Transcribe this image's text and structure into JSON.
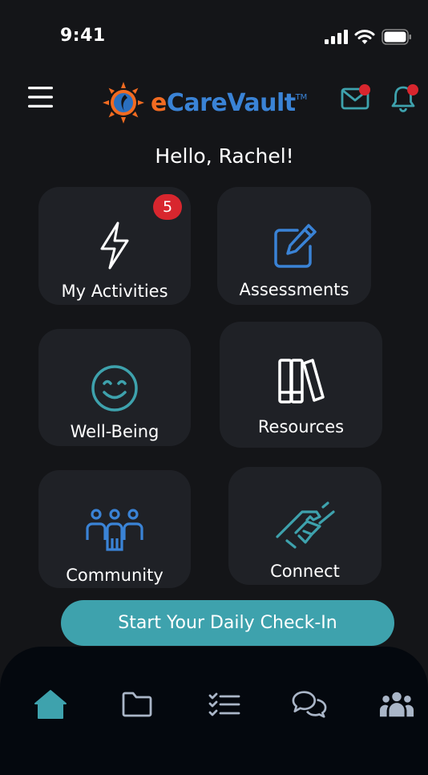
{
  "status": {
    "time": "9:41"
  },
  "brand": {
    "logo_e": "e",
    "logo_rest": "CareVault",
    "logo_tm": "TM"
  },
  "colors": {
    "accent": "#3ea2ad",
    "badge": "#d8262e",
    "logo_blue": "#3a83d6",
    "logo_orange": "#f26b21",
    "tile_bg": "#1f2126",
    "tabbar_bg": "#04080e"
  },
  "greeting": "Hello, Rachel!",
  "tiles": [
    {
      "label": "My Activities",
      "icon": "lightning-icon",
      "badge": "5"
    },
    {
      "label": "Assessments",
      "icon": "edit-icon"
    },
    {
      "label": "Well-Being",
      "icon": "smile-icon"
    },
    {
      "label": "Resources",
      "icon": "books-icon"
    },
    {
      "label": "Community",
      "icon": "community-icon"
    },
    {
      "label": "Connect",
      "icon": "handshake-icon"
    }
  ],
  "cta": {
    "label": "Start Your Daily Check-In"
  },
  "tabbar": [
    {
      "icon": "home-icon",
      "active": true
    },
    {
      "icon": "folder-icon",
      "active": false
    },
    {
      "icon": "checklist-icon",
      "active": false
    },
    {
      "icon": "chat-icon",
      "active": false
    },
    {
      "icon": "people-icon",
      "active": false
    }
  ]
}
